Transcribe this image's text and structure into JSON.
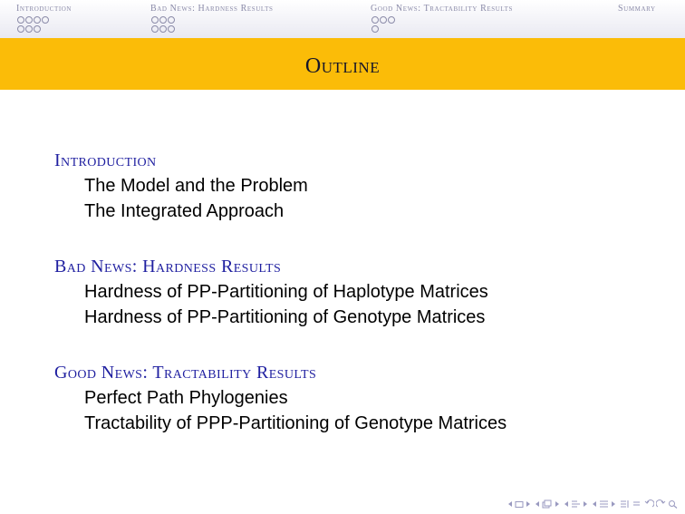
{
  "navbar": {
    "sections": [
      {
        "label": "Introduction",
        "dots": [
          4,
          3
        ]
      },
      {
        "label": "Bad News: Hardness Results",
        "dots": [
          3,
          3
        ]
      },
      {
        "label": "Good News: Tractability Results",
        "dots": [
          3,
          1
        ]
      },
      {
        "label": "Summary",
        "dots": [
          0,
          0
        ]
      }
    ]
  },
  "frame": {
    "title": "Outline"
  },
  "outline": [
    {
      "section": "Introduction",
      "subsections": [
        "The Model and the Problem",
        "The Integrated Approach"
      ]
    },
    {
      "section": "Bad News: Hardness Results",
      "subsections": [
        "Hardness of PP-Partitioning of Haplotype Matrices",
        "Hardness of PP-Partitioning of Genotype Matrices"
      ]
    },
    {
      "section": "Good News: Tractability Results",
      "subsections": [
        "Perfect Path Phylogenies",
        "Tractability of PPP-Partitioning of Genotype Matrices"
      ]
    }
  ],
  "colors": {
    "title_band": "#fbbc08",
    "section_text": "#1f1fa0",
    "nav_text": "#8a8aa8"
  },
  "icons": [
    "nav-prev-slide-icon",
    "nav-slide-icon",
    "nav-next-slide-icon",
    "nav-prev-frame-icon",
    "nav-frame-icon",
    "nav-next-frame-icon",
    "nav-prev-subsection-icon",
    "nav-subsection-icon",
    "nav-next-subsection-icon",
    "nav-prev-section-icon",
    "nav-section-icon",
    "nav-next-section-icon",
    "nav-back-icon",
    "nav-forward-icon",
    "nav-search-icon"
  ]
}
